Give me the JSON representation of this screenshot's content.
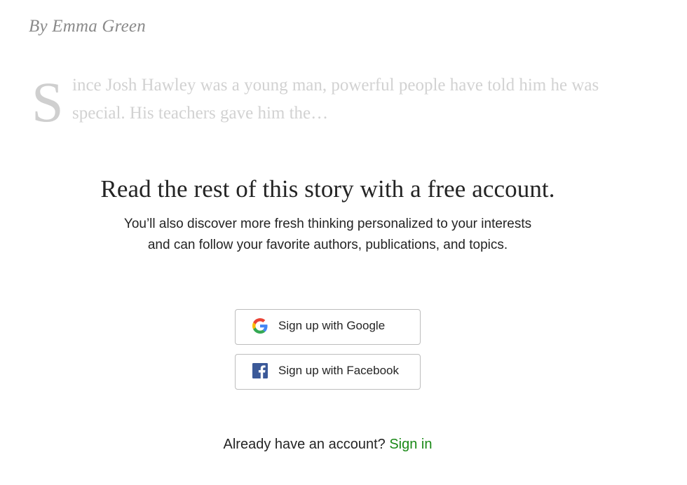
{
  "article": {
    "byline": "By Emma Green",
    "dropcap": "S",
    "excerpt": "ince Josh Hawley was a young man, powerful people have told him he was special. His teachers gave him the…"
  },
  "paywall": {
    "headline": "Read the rest of this story with a free account.",
    "subtext": "You’ll also discover more fresh thinking personalized to your interests and can follow your favorite authors, publications, and topics."
  },
  "buttons": {
    "google": {
      "label": "Sign up with Google",
      "icon": "google-icon"
    },
    "facebook": {
      "label": "Sign up with Facebook",
      "icon": "facebook-icon"
    }
  },
  "signin": {
    "prompt": "Already have an account?",
    "link": "Sign in"
  },
  "colors": {
    "link_green": "#1a8917",
    "facebook_blue": "#3b5998",
    "text": "#242424"
  }
}
